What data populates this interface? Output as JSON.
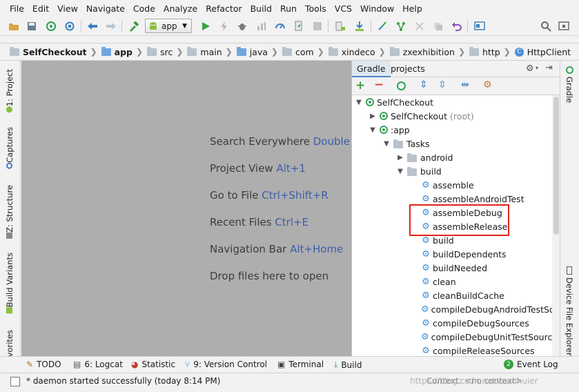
{
  "menu": [
    "File",
    "Edit",
    "View",
    "Navigate",
    "Code",
    "Analyze",
    "Refactor",
    "Build",
    "Run",
    "Tools",
    "VCS",
    "Window",
    "Help"
  ],
  "toolbar": {
    "run_config": "app",
    "icons": [
      "open-icon",
      "save-icon",
      "sync-icon",
      "refresh-icon",
      "back-icon",
      "forward-icon",
      "make-project-icon",
      "run-icon",
      "apply-changes-icon",
      "debug-icon",
      "profile-icon",
      "attach-debugger-icon",
      "stop-icon",
      "sdk-manager-icon",
      "avd-manager-icon",
      "gradle-sync-icon",
      "layout-inspector-icon",
      "undo-icon",
      "project-structure-icon",
      "search-icon"
    ]
  },
  "breadcrumb": [
    "SelfCheckout",
    "app",
    "src",
    "main",
    "java",
    "com",
    "xindeco",
    "zxexhibition",
    "http",
    "HttpClient"
  ],
  "left_tabs": [
    "1: Project",
    "Captures",
    "Z: Structure",
    "Build Variants",
    "avorites"
  ],
  "editor_hints": [
    {
      "label": "Search Everywhere",
      "key": "Double Sh"
    },
    {
      "label": "Project View",
      "key": "Alt+1"
    },
    {
      "label": "Go to File",
      "key": "Ctrl+Shift+R"
    },
    {
      "label": "Recent Files",
      "key": "Ctrl+E"
    },
    {
      "label": "Navigation Bar",
      "key": "Alt+Home"
    },
    {
      "label": "Drop files here to open",
      "key": ""
    }
  ],
  "gradle": {
    "tabs": [
      "Gradle",
      "projects"
    ],
    "tree": [
      {
        "label": "SelfCheckout",
        "extra": ""
      },
      {
        "label": "SelfCheckout",
        "extra": "(root)"
      },
      {
        "label": ":app",
        "extra": ""
      },
      {
        "label": "Tasks",
        "extra": ""
      },
      {
        "label": "android",
        "extra": ""
      },
      {
        "label": "build",
        "extra": ""
      },
      {
        "label": "assemble",
        "extra": ""
      },
      {
        "label": "assembleAndroidTest",
        "extra": ""
      },
      {
        "label": "assembleDebug",
        "extra": ""
      },
      {
        "label": "assembleRelease",
        "extra": ""
      },
      {
        "label": "build",
        "extra": ""
      },
      {
        "label": "buildDependents",
        "extra": ""
      },
      {
        "label": "buildNeeded",
        "extra": ""
      },
      {
        "label": "clean",
        "extra": ""
      },
      {
        "label": "cleanBuildCache",
        "extra": ""
      },
      {
        "label": "compileDebugAndroidTestSource",
        "extra": ""
      },
      {
        "label": "compileDebugSources",
        "extra": ""
      },
      {
        "label": "compileDebugUnitTestSources",
        "extra": ""
      },
      {
        "label": "compileReleaseSources",
        "extra": ""
      }
    ]
  },
  "right_tabs": [
    "Gradle",
    "Device File Explorer"
  ],
  "bottom_tabs": [
    {
      "label": "TODO"
    },
    {
      "label": "6: Logcat"
    },
    {
      "label": "Statistic"
    },
    {
      "label": "9: Version Control"
    },
    {
      "label": "Terminal"
    },
    {
      "label": "Build"
    },
    {
      "label": "Event Log",
      "badge": "2"
    }
  ],
  "status": {
    "message": "* daemon started successfully (today 8:14 PM)",
    "context": "Context: <no context>",
    "watermark": "https://blog.csdn.net/maohuier"
  },
  "colors": {
    "highlight": "#e3231b",
    "accent": "#4a86c7",
    "gradle_green": "#3aa25a"
  }
}
